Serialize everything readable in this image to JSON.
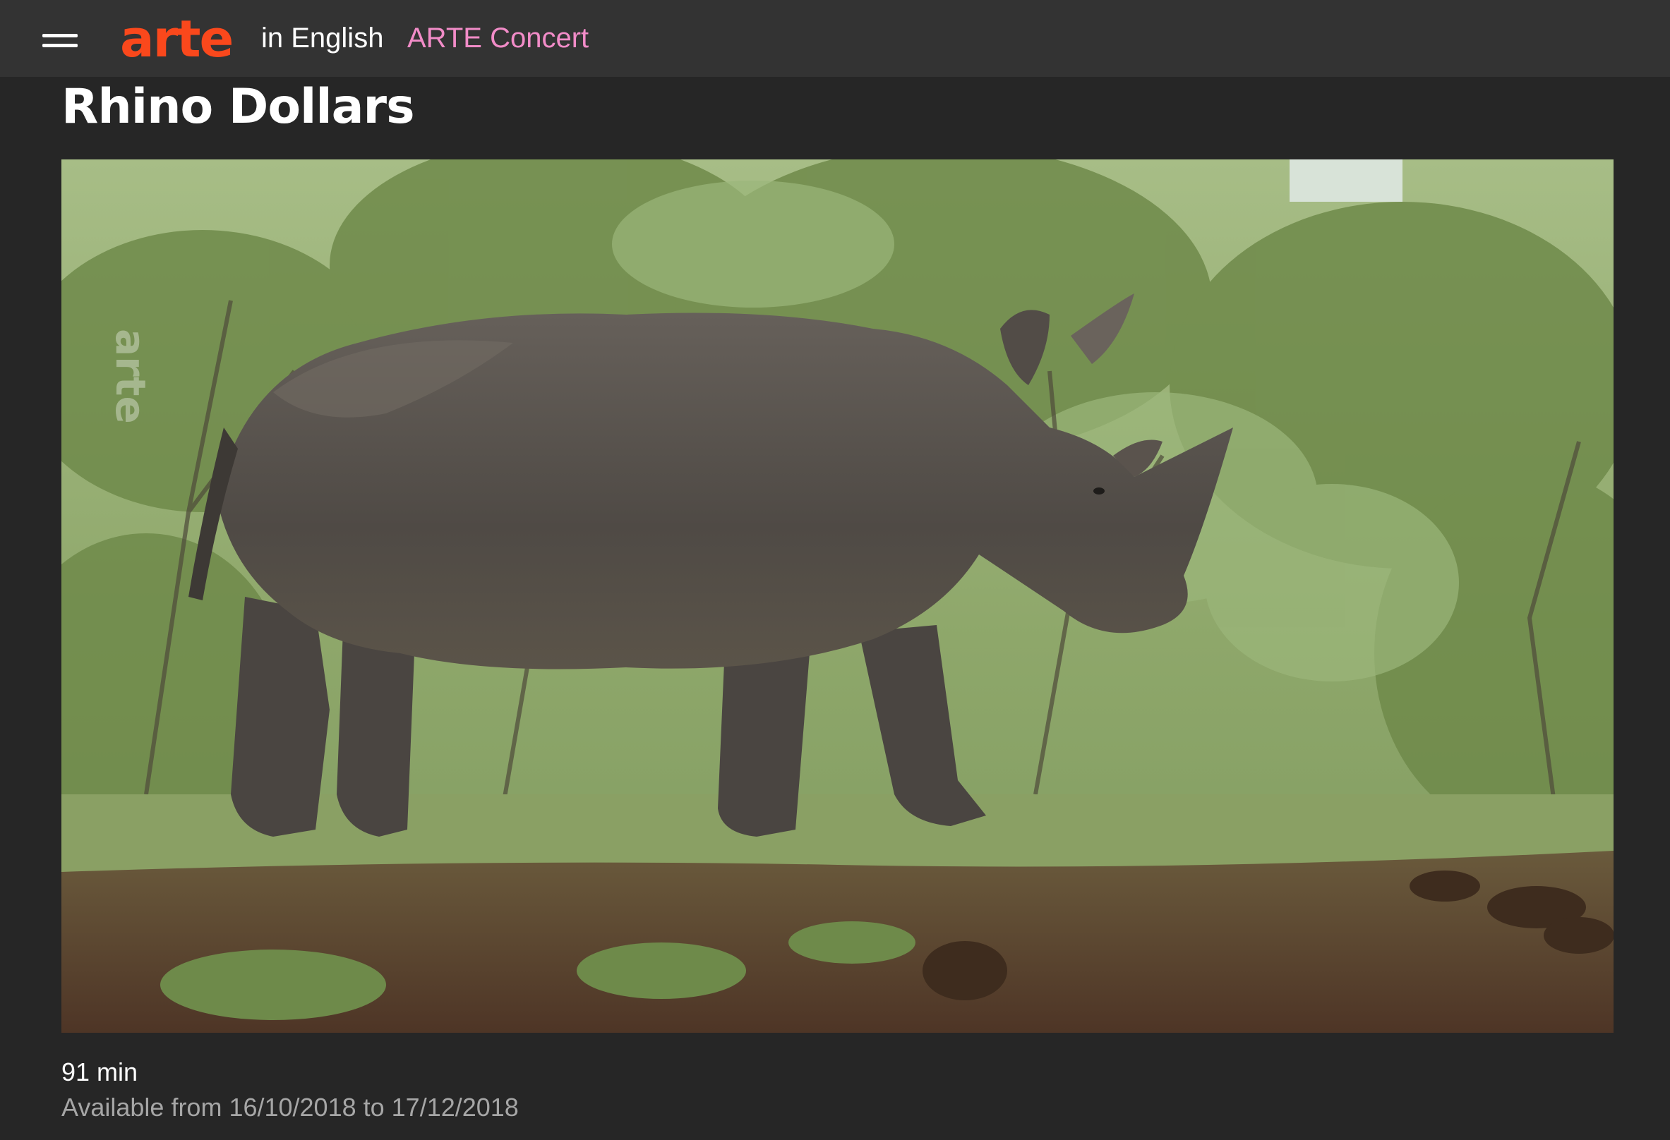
{
  "header": {
    "menu_icon": "hamburger-menu-icon",
    "logo_text": "arte",
    "site_language": "in English",
    "nav_link": "ARTE Concert",
    "brand_color": "#fa481c",
    "nav_link_color": "#f28cc8"
  },
  "program": {
    "title": "Rhino Dollars",
    "duration": "91 min",
    "availability": "Available from 16/10/2018 to 17/12/2018"
  },
  "player": {
    "watermark": "arte"
  }
}
